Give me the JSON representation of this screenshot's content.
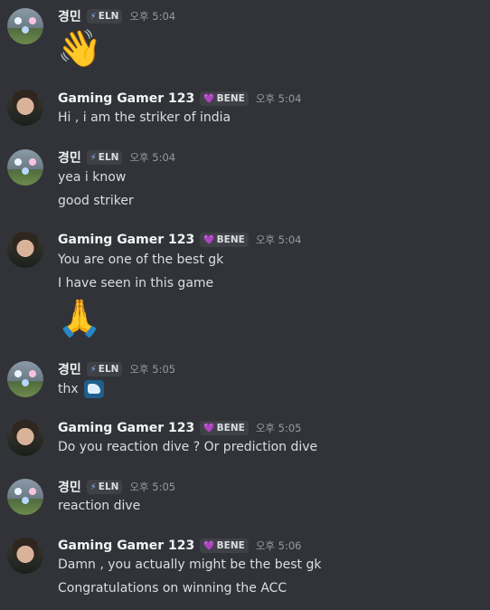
{
  "users": {
    "gyeong": {
      "name": "경민",
      "tag": "ELN",
      "tag_icon": "⚡"
    },
    "gamer": {
      "name": "Gaming Gamer 123",
      "tag": "BENE",
      "tag_icon": "💜"
    }
  },
  "messages": [
    {
      "time": "오후 5:04",
      "emoji": "👋"
    },
    {
      "time": "오후 5:04",
      "lines": [
        "Hi , i am the striker of india"
      ]
    },
    {
      "time": "오후 5:04",
      "lines": [
        "yea i know",
        "good striker"
      ]
    },
    {
      "time": "오후 5:04",
      "lines": [
        "You are one of the best gk",
        "I have seen in this game"
      ],
      "emoji": "🙏"
    },
    {
      "time": "오후 5:05",
      "lines": [
        "thx"
      ]
    },
    {
      "time": "오후 5:05",
      "lines": [
        "Do you reaction dive ? Or prediction dive"
      ]
    },
    {
      "time": "오후 5:05",
      "lines": [
        "reaction dive"
      ]
    },
    {
      "time": "오후 5:06",
      "lines": [
        "Damn , you actually might be the best gk",
        "Congratulations on winning the ACC"
      ]
    }
  ]
}
